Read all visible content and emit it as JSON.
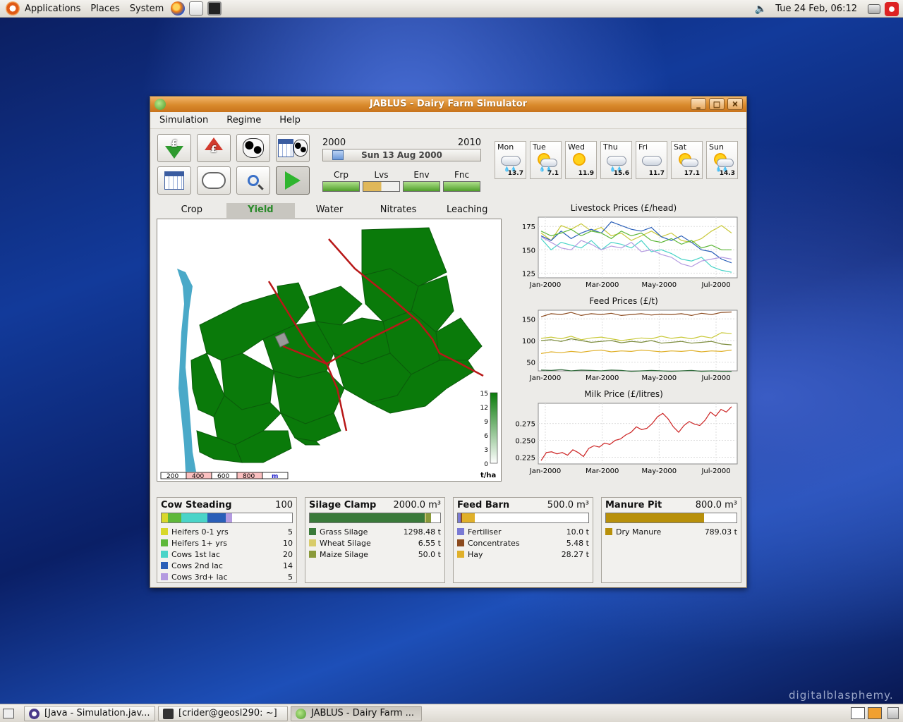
{
  "top_panel": {
    "menus": [
      "Applications",
      "Places",
      "System"
    ],
    "clock": "Tue 24 Feb, 06:12"
  },
  "window": {
    "title": "JABLUS - Dairy Farm Simulator",
    "controls": [
      "_",
      "□",
      "✕"
    ]
  },
  "menubar": [
    "Simulation",
    "Regime",
    "Help"
  ],
  "timeline": {
    "start_year": "2000",
    "end_year": "2010",
    "date": "Sun 13 Aug 2000",
    "progress": 0.06
  },
  "meters": [
    {
      "label": "Crp",
      "level": 1.0
    },
    {
      "label": "Lvs",
      "level": 0.5
    },
    {
      "label": "Env",
      "level": 1.0
    },
    {
      "label": "Fnc",
      "level": 1.0
    }
  ],
  "weather": [
    {
      "day": "Mon",
      "temp": "13.7",
      "icon": "rain-cloud-icon"
    },
    {
      "day": "Tue",
      "temp": "7.1",
      "icon": "sun-rain-icon"
    },
    {
      "day": "Wed",
      "temp": "11.9",
      "icon": "sun-icon"
    },
    {
      "day": "Thu",
      "temp": "15.6",
      "icon": "rain-cloud-icon"
    },
    {
      "day": "Fri",
      "temp": "11.7",
      "icon": "cloud-icon"
    },
    {
      "day": "Sat",
      "temp": "17.1",
      "icon": "sun-cloud-icon"
    },
    {
      "day": "Sun",
      "temp": "14.3",
      "icon": "sun-rain-icon"
    }
  ],
  "tabs": [
    "Crop",
    "Yield",
    "Water",
    "Nitrates",
    "Leaching"
  ],
  "selected_tab": "Yield",
  "map": {
    "scale_labels": [
      "200",
      "400",
      "600",
      "800",
      "m"
    ],
    "legend_ticks": [
      "15",
      "12",
      "9",
      "6",
      "3",
      "0"
    ],
    "legend_unit": "t/ha"
  },
  "chart_data": [
    {
      "type": "line",
      "title": "Livestock Prices (£/head)",
      "x": [
        "Jan-2000",
        "Mar-2000",
        "May-2000",
        "Jul-2000"
      ],
      "ylim": [
        120,
        185
      ],
      "yticks": [
        "175",
        "150",
        "125"
      ],
      "series": [
        {
          "color": "#c9c93a",
          "values": [
            168,
            160,
            176,
            172,
            178,
            170,
            174,
            165,
            168,
            160,
            165,
            170,
            164,
            168,
            160,
            158,
            162,
            170,
            176,
            168
          ]
        },
        {
          "color": "#2a5fb8",
          "values": [
            165,
            160,
            170,
            162,
            168,
            172,
            168,
            180,
            176,
            172,
            170,
            174,
            164,
            160,
            165,
            158,
            150,
            148,
            140,
            136
          ]
        },
        {
          "color": "#4ad4c8",
          "values": [
            162,
            150,
            158,
            155,
            152,
            160,
            150,
            158,
            156,
            152,
            160,
            148,
            150,
            146,
            140,
            138,
            142,
            132,
            128,
            126
          ]
        },
        {
          "color": "#b49ae0",
          "values": [
            164,
            158,
            152,
            150,
            160,
            156,
            150,
            154,
            152,
            158,
            148,
            150,
            145,
            142,
            135,
            132,
            138,
            140,
            142,
            140
          ]
        },
        {
          "color": "#5fb83a",
          "values": [
            170,
            165,
            168,
            172,
            165,
            170,
            168,
            162,
            170,
            165,
            168,
            160,
            158,
            162,
            156,
            160,
            152,
            155,
            150,
            150
          ]
        }
      ]
    },
    {
      "type": "line",
      "title": "Feed Prices (£/t)",
      "x": [
        "Jan-2000",
        "Mar-2000",
        "May-2000",
        "Jul-2000"
      ],
      "ylim": [
        30,
        170
      ],
      "yticks": [
        "150",
        "100",
        "50"
      ],
      "series": [
        {
          "color": "#8b4a1e",
          "values": [
            155,
            162,
            160,
            165,
            158,
            162,
            160,
            163,
            158,
            160,
            162,
            159,
            161,
            160,
            162,
            158,
            163,
            160,
            165,
            166
          ]
        },
        {
          "color": "#c9c93a",
          "values": [
            105,
            108,
            104,
            110,
            102,
            106,
            108,
            104,
            100,
            103,
            106,
            104,
            110,
            105,
            108,
            104,
            110,
            106,
            118,
            116
          ]
        },
        {
          "color": "#7a8a3a",
          "values": [
            100,
            102,
            98,
            104,
            100,
            96,
            98,
            100,
            95,
            98,
            96,
            100,
            94,
            96,
            98,
            94,
            96,
            98,
            92,
            90
          ]
        },
        {
          "color": "#e0b02a",
          "values": [
            70,
            74,
            72,
            75,
            73,
            76,
            78,
            74,
            76,
            75,
            78,
            76,
            74,
            76,
            75,
            77,
            74,
            76,
            75,
            78
          ]
        },
        {
          "color": "#2f6a3a",
          "values": [
            32,
            31,
            33,
            30,
            32,
            31,
            30,
            32,
            31,
            29,
            30,
            31,
            30,
            29,
            30,
            31,
            29,
            30,
            29,
            29
          ]
        }
      ]
    },
    {
      "type": "line",
      "title": "Milk Price (£/litres)",
      "x": [
        "Jan-2000",
        "Mar-2000",
        "May-2000",
        "Jul-2000"
      ],
      "ylim": [
        0.215,
        0.305
      ],
      "yticks": [
        "0.275",
        "0.250",
        "0.225"
      ],
      "series": [
        {
          "color": "#cc2222",
          "values": [
            0.22,
            0.232,
            0.233,
            0.23,
            0.232,
            0.228,
            0.236,
            0.232,
            0.226,
            0.238,
            0.242,
            0.24,
            0.246,
            0.244,
            0.25,
            0.252,
            0.258,
            0.262,
            0.27,
            0.266,
            0.268,
            0.275,
            0.285,
            0.29,
            0.282,
            0.27,
            0.262,
            0.272,
            0.278,
            0.274,
            0.272,
            0.28,
            0.292,
            0.286,
            0.296,
            0.292,
            0.3
          ]
        }
      ]
    }
  ],
  "stores": [
    {
      "name": "Cow Steading",
      "capacity": "100",
      "bar": [
        {
          "c": "#d8d82a",
          "w": 0.05
        },
        {
          "c": "#5fb83a",
          "w": 0.1
        },
        {
          "c": "#4ad4c8",
          "w": 0.2
        },
        {
          "c": "#2a5fb8",
          "w": 0.14
        },
        {
          "c": "#b49ae0",
          "w": 0.05
        }
      ],
      "items": [
        {
          "label": "Heifers 0-1 yrs",
          "value": "5",
          "color": "#d8d82a"
        },
        {
          "label": "Heifers 1+ yrs",
          "value": "10",
          "color": "#5fb83a"
        },
        {
          "label": "Cows 1st lac",
          "value": "20",
          "color": "#4ad4c8"
        },
        {
          "label": "Cows 2nd lac",
          "value": "14",
          "color": "#2a5fb8"
        },
        {
          "label": "Cows 3rd+ lac",
          "value": "5",
          "color": "#b49ae0"
        }
      ]
    },
    {
      "name": "Silage Clamp",
      "capacity": "2000.0 m³",
      "bar": [
        {
          "c": "#3a7a3a",
          "w": 0.88
        },
        {
          "c": "#c9c070",
          "w": 0.01
        },
        {
          "c": "#8a9a3a",
          "w": 0.04
        }
      ],
      "items": [
        {
          "label": "Grass Silage",
          "value": "1298.48 t",
          "color": "#3a7a3a"
        },
        {
          "label": "Wheat Silage",
          "value": "6.55 t",
          "color": "#d8cc6a"
        },
        {
          "label": "Maize Silage",
          "value": "50.0 t",
          "color": "#8a9a3a"
        }
      ]
    },
    {
      "name": "Feed Barn",
      "capacity": "500.0 m³",
      "bar": [
        {
          "c": "#7a7ad4",
          "w": 0.02
        },
        {
          "c": "#8b4a1e",
          "w": 0.01
        },
        {
          "c": "#e0b02a",
          "w": 0.1
        }
      ],
      "items": [
        {
          "label": "Fertiliser",
          "value": "10.0 t",
          "color": "#7a7ad4"
        },
        {
          "label": "Concentrates",
          "value": "5.48 t",
          "color": "#8b4a1e"
        },
        {
          "label": "Hay",
          "value": "28.27 t",
          "color": "#e0b02a"
        }
      ]
    },
    {
      "name": "Manure Pit",
      "capacity": "800.0 m³",
      "bar": [
        {
          "c": "#b8900a",
          "w": 0.75
        }
      ],
      "items": [
        {
          "label": "Dry Manure",
          "value": "789.03 t",
          "color": "#b8900a"
        }
      ]
    }
  ],
  "taskbar": [
    "[Java - Simulation.jav...",
    "[crider@geosl290: ~]",
    "JABLUS - Dairy Farm ..."
  ],
  "watermark": "digitalblasphemy."
}
